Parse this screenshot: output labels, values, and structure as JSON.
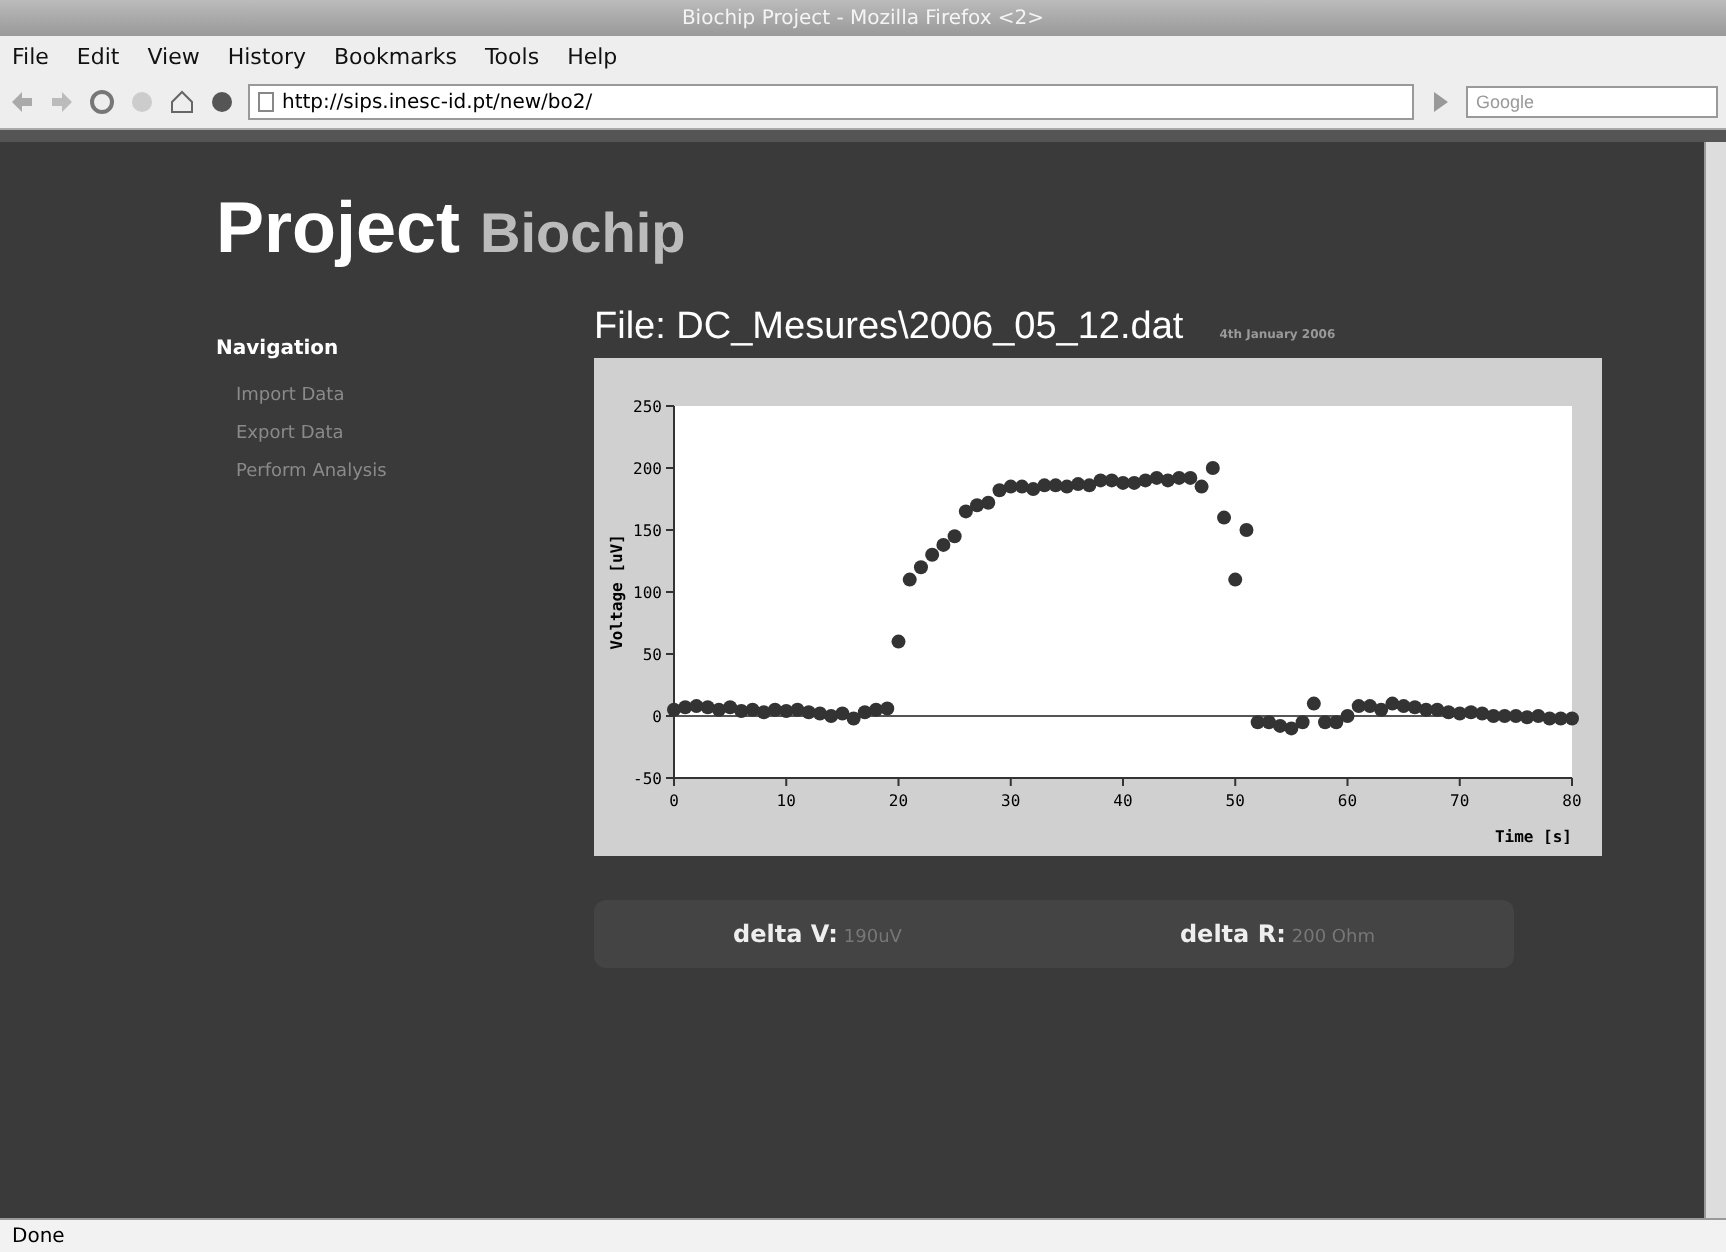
{
  "window": {
    "title": "Biochip Project - Mozilla Firefox <2>"
  },
  "menu": [
    "File",
    "Edit",
    "View",
    "History",
    "Bookmarks",
    "Tools",
    "Help"
  ],
  "address": {
    "value": "http://sips.inesc-id.pt/new/bo2/"
  },
  "search": {
    "placeholder": "Google"
  },
  "header": {
    "title": "Project",
    "subtitle": "Biochip"
  },
  "navigation": {
    "heading": "Navigation",
    "items": [
      "Import Data",
      "Export Data",
      "Perform Analysis"
    ]
  },
  "file": {
    "title": "File: DC_Mesures\\2006_05_12.dat",
    "date": "4th January 2006"
  },
  "chart_data": {
    "type": "scatter",
    "xlabel": "Time [s]",
    "ylabel": "Voltage [uV]",
    "xlim": [
      0,
      80
    ],
    "ylim": [
      -50,
      250
    ],
    "xticks": [
      0,
      10,
      20,
      30,
      40,
      50,
      60,
      70,
      80
    ],
    "yticks": [
      -50,
      0,
      50,
      100,
      150,
      200,
      250
    ],
    "x": [
      0,
      1,
      2,
      3,
      4,
      5,
      6,
      7,
      8,
      9,
      10,
      11,
      12,
      13,
      14,
      15,
      16,
      17,
      18,
      19,
      20,
      21,
      22,
      23,
      24,
      25,
      26,
      27,
      28,
      29,
      30,
      31,
      32,
      33,
      34,
      35,
      36,
      37,
      38,
      39,
      40,
      41,
      42,
      43,
      44,
      45,
      46,
      47,
      48,
      49,
      50,
      51,
      52,
      53,
      54,
      55,
      56,
      57,
      58,
      59,
      60,
      61,
      62,
      63,
      64,
      65,
      66,
      67,
      68,
      69,
      70,
      71,
      72,
      73,
      74,
      75,
      76,
      77,
      78,
      79,
      80
    ],
    "series": [
      {
        "color": "#333333",
        "values": [
          5,
          7,
          8,
          7,
          5,
          7,
          4,
          5,
          3,
          5,
          4,
          5,
          3,
          2,
          0,
          2,
          -2,
          3,
          5,
          6,
          60,
          110,
          120,
          130,
          138,
          145,
          165,
          170,
          172,
          182,
          185,
          185,
          183,
          186,
          186,
          185,
          187,
          186,
          190,
          190,
          188,
          188,
          190,
          192,
          190,
          192,
          192,
          185,
          200,
          160,
          110,
          150,
          -5,
          -5,
          -8,
          -10,
          -5,
          10,
          -5,
          -5,
          0,
          8,
          8,
          5,
          10,
          8,
          7,
          5,
          5,
          3,
          2,
          3,
          2,
          0,
          0,
          0,
          -1,
          0,
          -2,
          -2,
          -2
        ]
      }
    ]
  },
  "results": [
    {
      "label": "delta V:",
      "value": "190uV"
    },
    {
      "label": "delta R:",
      "value": "200 Ohm"
    }
  ],
  "status_bar": {
    "text": "Done"
  }
}
